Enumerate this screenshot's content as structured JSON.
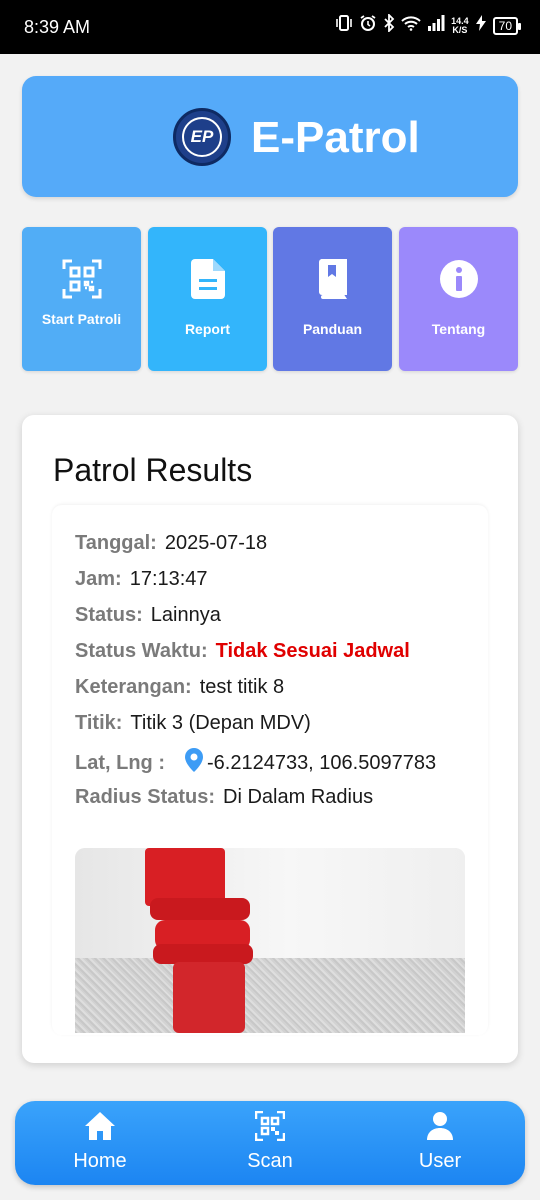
{
  "status_bar": {
    "time": "8:39 AM",
    "network_speed_value": "14.4",
    "network_speed_unit": "K/S",
    "battery": "70"
  },
  "header": {
    "logo_text": "EP",
    "app_title": "E-Patrol"
  },
  "menu": [
    {
      "label": "Start Patroli",
      "icon": "qr-code-icon",
      "color": "#51adf6"
    },
    {
      "label": "Report",
      "icon": "document-icon",
      "color": "#33b5fb"
    },
    {
      "label": "Panduan",
      "icon": "book-icon",
      "color": "#6178e4"
    },
    {
      "label": "Tentang",
      "icon": "info-icon",
      "color": "#9b89fb"
    }
  ],
  "results": {
    "title": "Patrol Results",
    "fields": {
      "tanggal": {
        "label": "Tanggal:",
        "value": "2025-07-18"
      },
      "jam": {
        "label": "Jam:",
        "value": "17:13:47"
      },
      "status": {
        "label": "Status:",
        "value": "Lainnya"
      },
      "status_waktu": {
        "label": "Status Waktu:",
        "value": "Tidak Sesuai Jadwal",
        "color": "#e00000"
      },
      "keterangan": {
        "label": "Keterangan:",
        "value": "test titik 8"
      },
      "titik": {
        "label": "Titik:",
        "value": "Titik 3 (Depan MDV)"
      },
      "latlng": {
        "label": "Lat, Lng :",
        "value": "-6.2124733, 106.5097783"
      },
      "radius": {
        "label": "Radius Status:",
        "value": "Di Dalam Radius"
      }
    }
  },
  "bottom_nav": [
    {
      "label": "Home",
      "icon": "home-icon"
    },
    {
      "label": "Scan",
      "icon": "qr-code-icon"
    },
    {
      "label": "User",
      "icon": "user-icon"
    }
  ],
  "colors": {
    "header_bg": "#55aaf9",
    "nav_bg": "#1c85f2",
    "alert_red": "#e00000"
  }
}
